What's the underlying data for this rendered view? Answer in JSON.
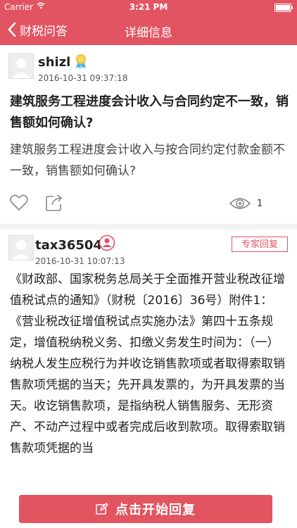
{
  "status_bar": {
    "carrier": "Carrier",
    "time": "3:21 PM"
  },
  "nav": {
    "back_label": "财税问答",
    "title": "详细信息"
  },
  "question": {
    "user": "shizl",
    "time": "2016-10-31 09:37:18",
    "title": "建筑服务工程进度会计收入与合同约定不一致，销售额如何确认?",
    "body": "建筑服务工程进度会计收入与按合同约定付款金额不一致，销售额如何确认?",
    "view_count": "1"
  },
  "answer": {
    "user": "tax36504",
    "time": "2016-10-31 10:07:13",
    "badge": "专家回复",
    "body": "《财政部、国家税务总局关于全面推开营业税改征增值税试点的通知》（财税〔2016〕36号）附件1：《营业税改征增值税试点实施办法》第四十五条规定，增值税纳税义务、扣缴义务发生时间为：（一）纳税人发生应税行为并收讫销售款项或者取得索取销售款项凭据的当天；先开具发票的，为开具发票的当天。收讫销售款项，是指纳税人销售服务、无形资产、不动产过程中或者完成后收到款项。取得索取销售款项凭据的当"
  },
  "reply_button": {
    "label": "点击开始回复"
  },
  "colors": {
    "brand": "#e25462"
  },
  "icons": [
    "wifi-icon",
    "battery-icon",
    "back-chevron-icon",
    "medal-icon",
    "expert-icon",
    "like-heart-icon",
    "share-icon",
    "eye-icon",
    "edit-icon"
  ]
}
